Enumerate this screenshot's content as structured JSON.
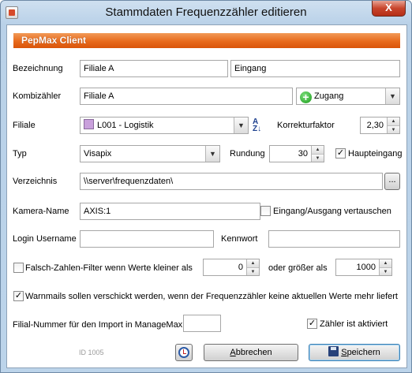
{
  "window": {
    "title": "Stammdaten Frequenzzähler editieren",
    "close_symbol": "X"
  },
  "banner": "PepMax Client",
  "bezeichnung": {
    "label": "Bezeichnung",
    "value1": "Filiale A",
    "value2": "Eingang"
  },
  "kombizaehler": {
    "label": "Kombizähler",
    "value": "Filiale A",
    "zugang": "Zugang"
  },
  "filiale": {
    "label": "Filiale",
    "value": "L001 - Logistik",
    "sort_icon": "A↓Z"
  },
  "korrekturfaktor": {
    "label": "Korrekturfaktor",
    "value": "2,30"
  },
  "typ": {
    "label": "Typ",
    "value": "Visapix"
  },
  "rundung": {
    "label": "Rundung",
    "value": "30"
  },
  "haupteingang": {
    "label": "Haupteingang",
    "checked": true
  },
  "verzeichnis": {
    "label": "Verzeichnis",
    "value": "\\\\server\\frequenzdaten\\",
    "browse": "..."
  },
  "kamera": {
    "label": "Kamera-Name",
    "value": "AXIS:1",
    "swap_label": "Eingang/Ausgang vertauschen"
  },
  "login": {
    "label": "Login Username",
    "value": "",
    "kennwort_label": "Kennwort",
    "kennwort": ""
  },
  "filter": {
    "label": "Falsch-Zahlen-Filter wenn Werte kleiner als",
    "min": "0",
    "oder_label": "oder größer als",
    "max": "1000"
  },
  "warnmails": {
    "label": "Warnmails sollen verschickt werden, wenn der Frequenzzähler keine aktuellen Werte mehr liefert",
    "checked": true
  },
  "filialnummer": {
    "label": "Filial-Nummer für den Import in ManageMax",
    "value": ""
  },
  "zaehler_aktiv": {
    "label": "Zähler ist aktiviert",
    "checked": true
  },
  "footer": {
    "id_text": "ID 1005",
    "cancel_label": "bbrechen",
    "cancel_key": "A",
    "save_label": "peichern",
    "save_key": "S"
  },
  "colors": {
    "banner": "#e86a1c",
    "accent": "#3c7fb1"
  }
}
